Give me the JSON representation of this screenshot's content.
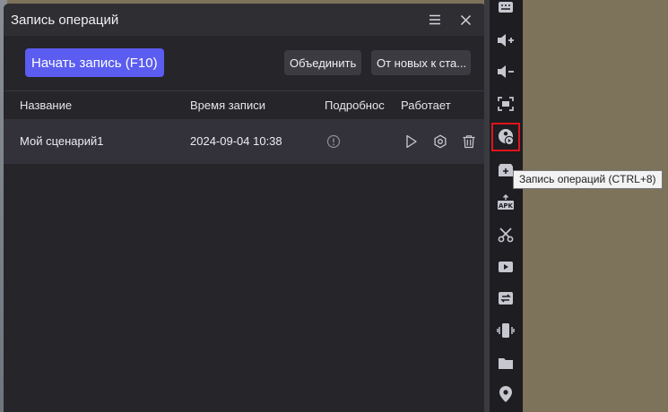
{
  "panel": {
    "title": "Запись операций",
    "start_record_label": "Начать запись (F10)",
    "merge_label": "Объединить",
    "sort_label": "От новых к ста..."
  },
  "table": {
    "headers": {
      "name": "Название",
      "time": "Время записи",
      "details": "Подробнос",
      "running": "Работает"
    },
    "rows": [
      {
        "name": "Мой сценарий1",
        "time": "2024-09-04 10:38"
      }
    ]
  },
  "sidebar": {
    "tooltip": "Запись операций (CTRL+8)",
    "items": [
      "keyboard-icon",
      "volume-up-icon",
      "volume-down-icon",
      "screenshot-icon",
      "operation-record-icon",
      "add-app-icon",
      "apk-install-icon",
      "scissors-icon",
      "video-record-icon",
      "sync-icon",
      "shake-icon",
      "folder-icon",
      "location-icon"
    ]
  },
  "colors": {
    "accent": "#5b5cf0",
    "highlight": "#e0141a"
  }
}
